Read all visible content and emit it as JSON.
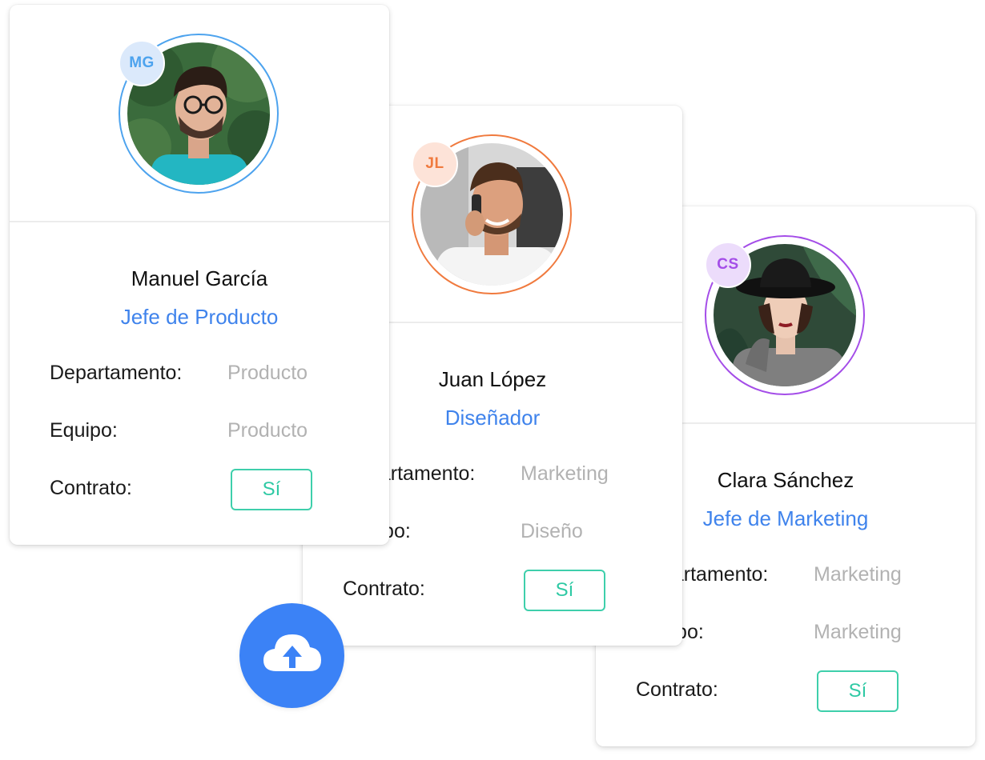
{
  "cards": [
    {
      "initials": "MG",
      "accent": "#4da3ee",
      "initials_bg": "#dbe9fb",
      "name": "Manuel García",
      "role": "Jefe de Producto",
      "department_label": "Departamento:",
      "department": "Producto",
      "team_label": "Equipo:",
      "team": "Producto",
      "contract_label": "Contrato:",
      "contract": "Sí"
    },
    {
      "initials": "JL",
      "accent": "#f07a3e",
      "initials_bg": "#fde3d8",
      "name": "Juan López",
      "role": "Diseñador",
      "department_label": "Departamento:",
      "department": "Marketing",
      "team_label": "Equipo:",
      "team": "Diseño",
      "contract_label": "Contrato:",
      "contract": "Sí"
    },
    {
      "initials": "CS",
      "accent": "#a44de8",
      "initials_bg": "#ecdcfb",
      "name": "Clara Sánchez",
      "role": "Jefe de Marketing",
      "department_label": "Departamento:",
      "department": "Marketing",
      "team_label": "Equipo:",
      "team": "Marketing",
      "contract_label": "Contrato:",
      "contract": "Sí"
    }
  ],
  "upload_button": {
    "icon": "cloud-upload-icon",
    "color": "#3b82f6"
  }
}
